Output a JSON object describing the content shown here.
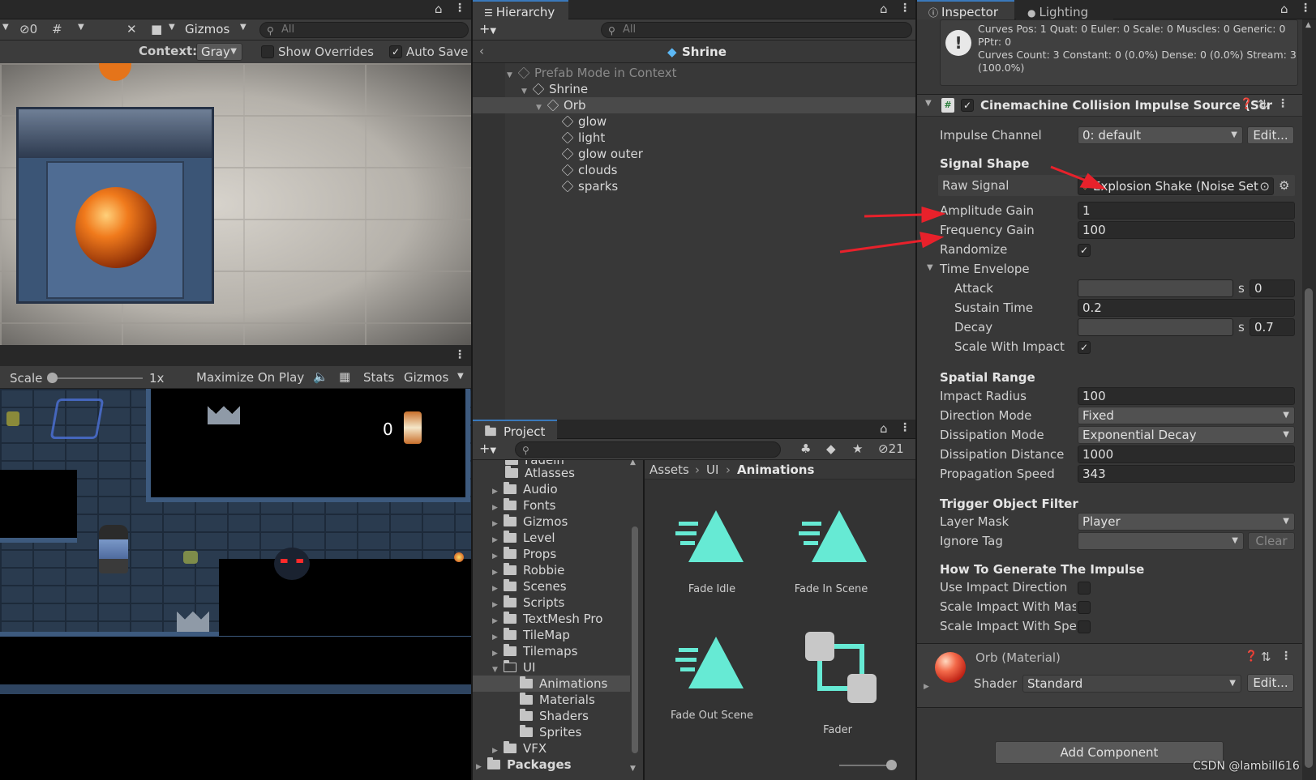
{
  "scene_toolbar": {
    "hidden_count": "0",
    "gizmos": "Gizmos",
    "search_placeholder": "All"
  },
  "prefab_bar": {
    "context_label": "Context:",
    "context_value": "Gray",
    "show_overrides": "Show Overrides",
    "auto_save": "Auto Save"
  },
  "game_toolbar": {
    "scale_label": "Scale",
    "scale_value": "1x",
    "maximize": "Maximize On Play",
    "stats": "Stats",
    "gizmos": "Gizmos",
    "score": "0"
  },
  "hierarchy": {
    "tab": "Hierarchy",
    "search_placeholder": "All",
    "breadcrumb": "Shrine",
    "items": [
      {
        "label": "Prefab Mode in Context"
      },
      {
        "label": "Shrine"
      },
      {
        "label": "Orb"
      },
      {
        "label": "glow"
      },
      {
        "label": "light"
      },
      {
        "label": "glow outer"
      },
      {
        "label": "clouds"
      },
      {
        "label": "sparks"
      }
    ]
  },
  "project": {
    "tab": "Project",
    "hidden_count": "21",
    "cut_item": "Fadeln",
    "tree": [
      {
        "label": "Atlasses"
      },
      {
        "label": "Audio"
      },
      {
        "label": "Fonts"
      },
      {
        "label": "Gizmos"
      },
      {
        "label": "Level"
      },
      {
        "label": "Props"
      },
      {
        "label": "Robbie"
      },
      {
        "label": "Scenes"
      },
      {
        "label": "Scripts"
      },
      {
        "label": "TextMesh Pro"
      },
      {
        "label": "TileMap"
      },
      {
        "label": "Tilemaps"
      },
      {
        "label": "UI"
      },
      {
        "label": "Animations"
      },
      {
        "label": "Materials"
      },
      {
        "label": "Shaders"
      },
      {
        "label": "Sprites"
      },
      {
        "label": "VFX"
      },
      {
        "label": "Packages"
      }
    ],
    "breadcrumb": [
      "Assets",
      "UI",
      "Animations"
    ],
    "assets": [
      {
        "label": "Fade Idle"
      },
      {
        "label": "Fade In Scene"
      },
      {
        "label": "Fade Out Scene"
      },
      {
        "label": "Fader"
      }
    ]
  },
  "inspector": {
    "tab": "Inspector",
    "lighting_tab": "Lighting",
    "info_lines": [
      "Curves Pos: 1 Quat: 0 Euler: 0 Scale: 0 Muscles: 0 Generic: 0",
      "PPtr: 0",
      "Curves Count: 3 Constant: 0 (0.0%) Dense: 0 (0.0%) Stream: 3",
      "(100.0%)"
    ],
    "component_title": "Cinemachine Collision Impulse Source (Scr",
    "impulse_channel_label": "Impulse Channel",
    "impulse_channel_value": "0: default",
    "edit": "Edit...",
    "signal_shape": "Signal Shape",
    "raw_signal_label": "Raw Signal",
    "raw_signal_value": "Explosion Shake (Noise Set",
    "amplitude_label": "Amplitude Gain",
    "amplitude_value": "1",
    "frequency_label": "Frequency Gain",
    "frequency_value": "100",
    "randomize_label": "Randomize",
    "time_envelope": "Time Envelope",
    "attack_label": "Attack",
    "attack_unit": "s",
    "attack_value": "0",
    "sustain_label": "Sustain Time",
    "sustain_value": "0.2",
    "decay_label": "Decay",
    "decay_unit": "s",
    "decay_value": "0.7",
    "scale_impact_label": "Scale With Impact",
    "spatial_range": "Spatial Range",
    "impact_radius_label": "Impact Radius",
    "impact_radius_value": "100",
    "direction_mode_label": "Direction Mode",
    "direction_mode_value": "Fixed",
    "dissipation_mode_label": "Dissipation Mode",
    "dissipation_mode_value": "Exponential Decay",
    "dissipation_distance_label": "Dissipation Distance",
    "dissipation_distance_value": "1000",
    "propagation_label": "Propagation Speed",
    "propagation_value": "343",
    "trigger_filter": "Trigger Object Filter",
    "layer_mask_label": "Layer Mask",
    "layer_mask_value": "Player",
    "ignore_tag_label": "Ignore Tag",
    "clear": "Clear",
    "how_to": "How To Generate The Impulse",
    "use_direction_label": "Use Impact Direction",
    "scale_mass_label": "Scale Impact With Mass",
    "scale_speed_label": "Scale Impact With Spee",
    "material_name": "Orb (Material)",
    "shader_label": "Shader",
    "shader_value": "Standard",
    "add_component": "Add Component"
  },
  "watermark": "CSDN @lambill616",
  "colors": {
    "accent": "#3a79bb",
    "teal": "#66ead4",
    "arrow": "#e8212b"
  }
}
